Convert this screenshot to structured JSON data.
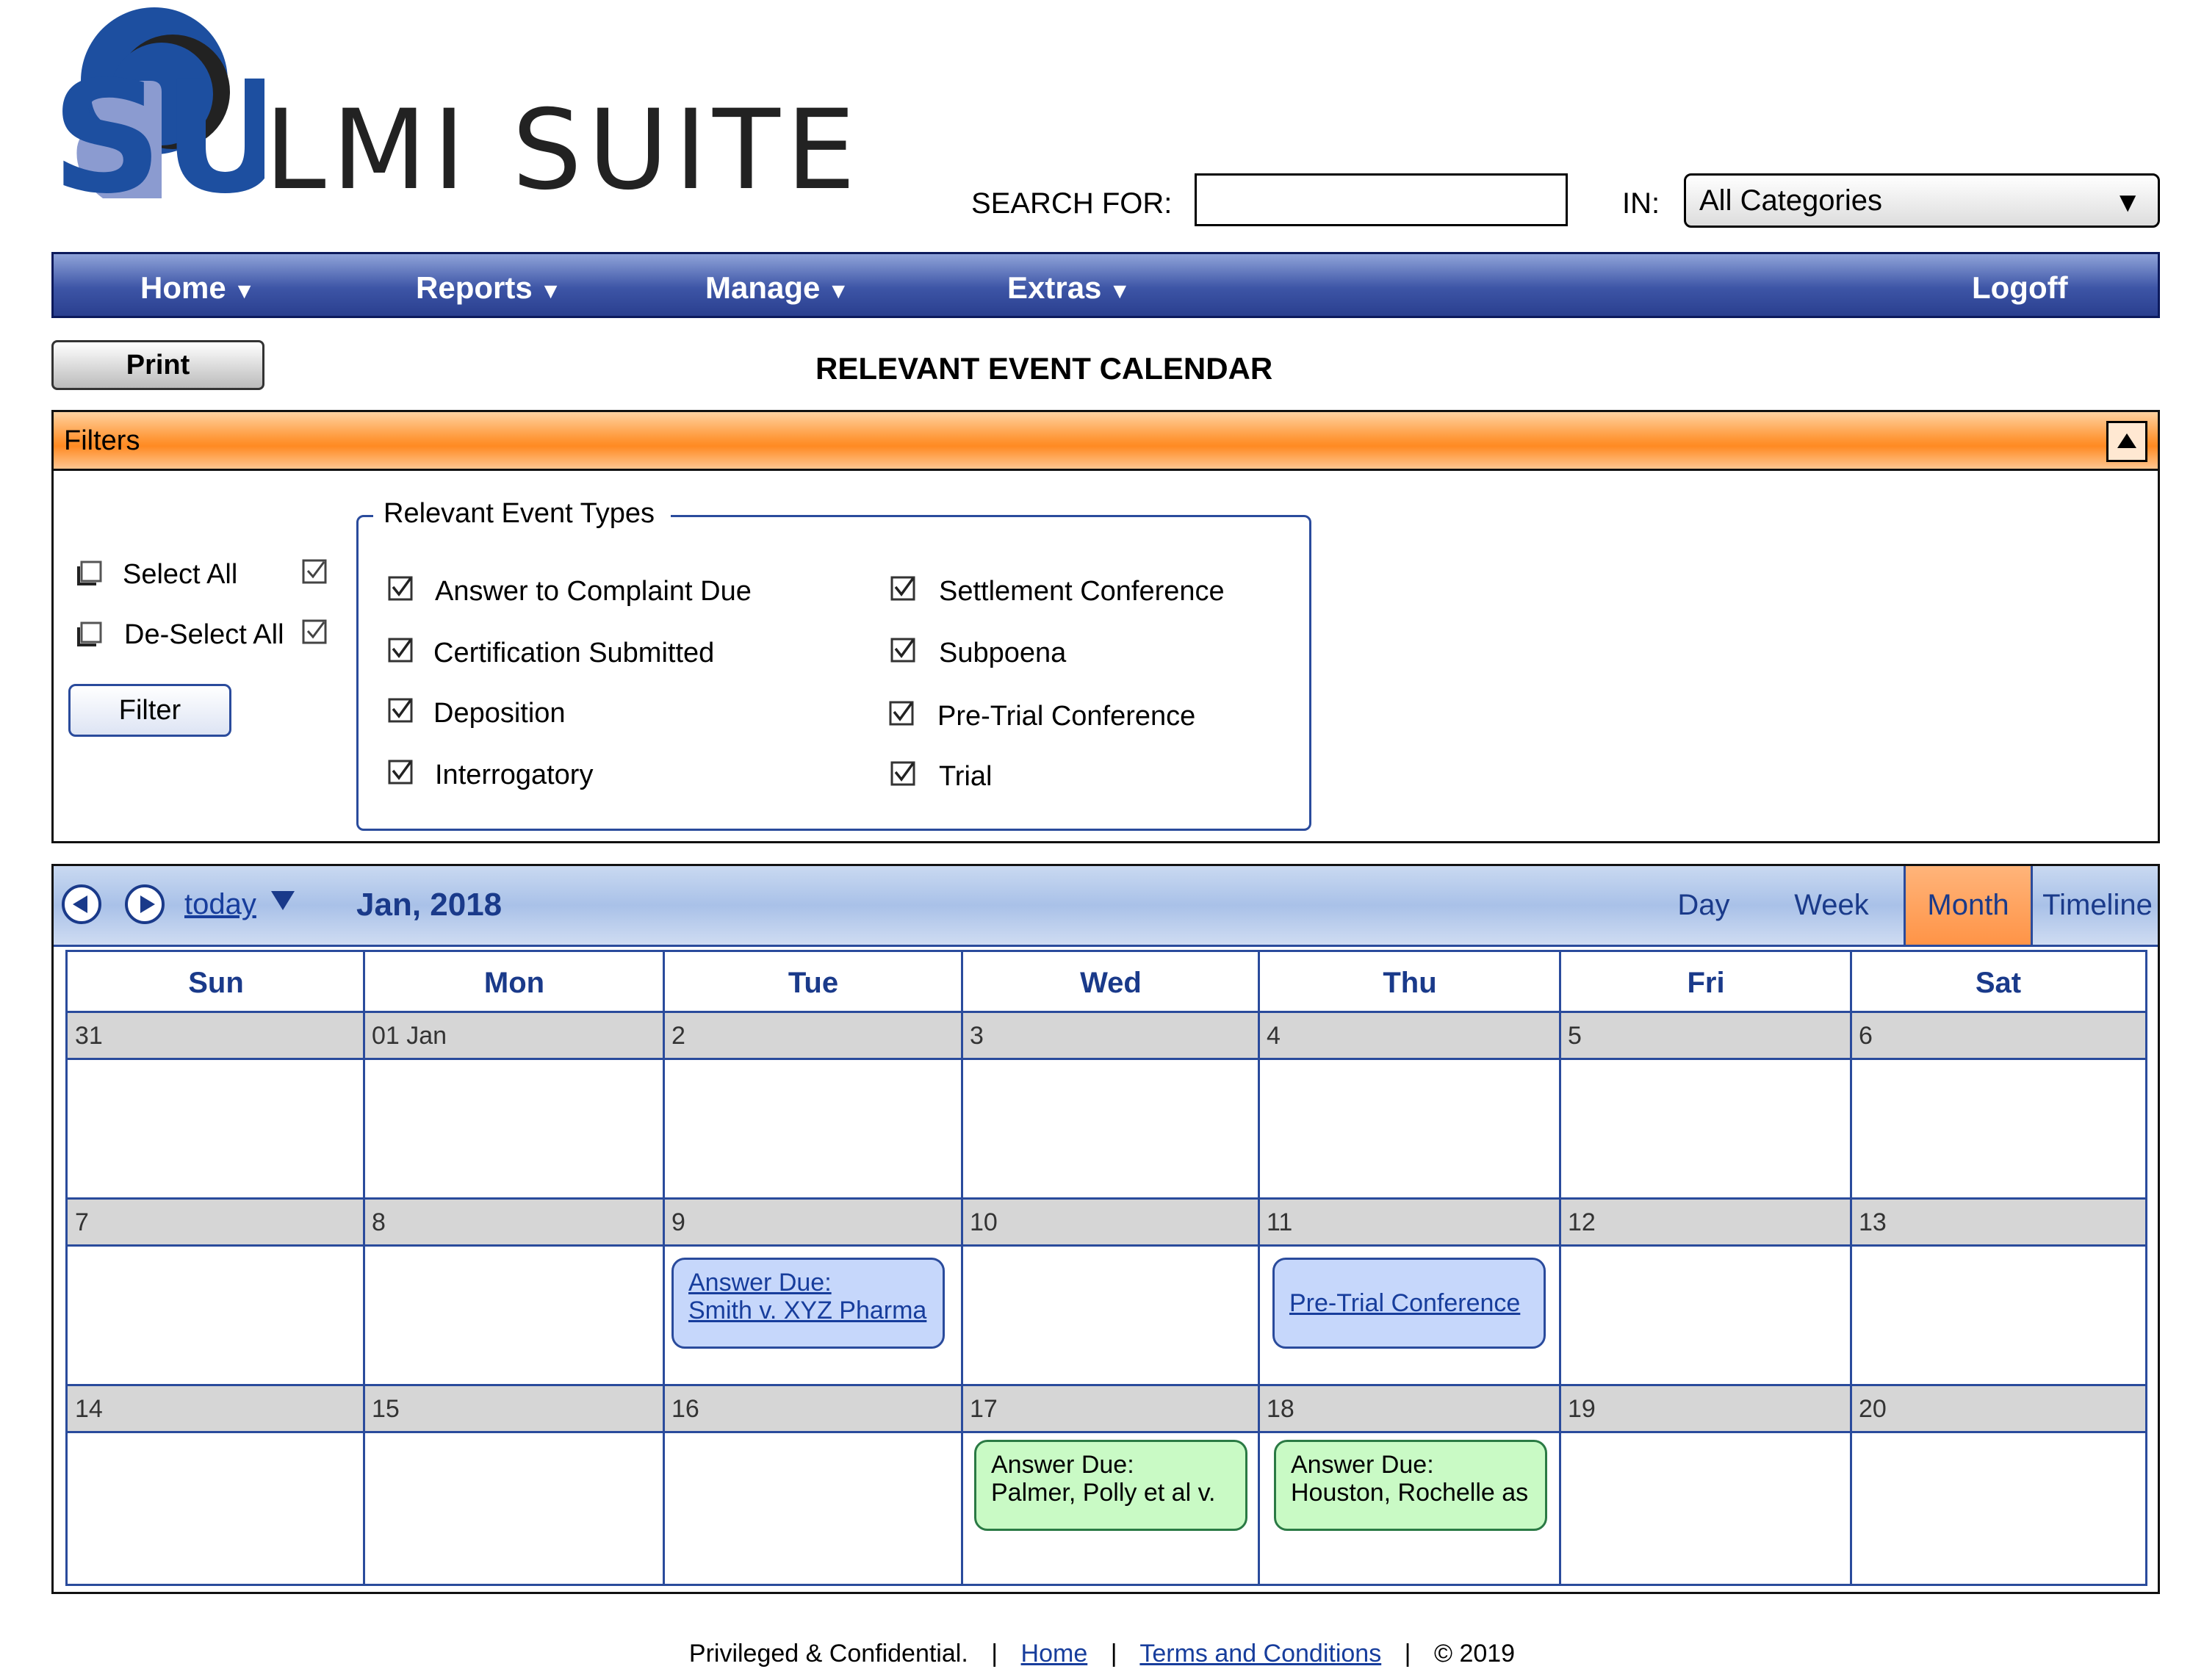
{
  "header": {
    "app_title": "LMI SUITE",
    "logo_letters": "SU",
    "search_label": "SEARCH FOR:",
    "search_value": "",
    "in_label": "IN:",
    "category_value": "All Categories"
  },
  "nav": {
    "items": [
      {
        "label": "Home",
        "has_dropdown": true
      },
      {
        "label": "Reports",
        "has_dropdown": true
      },
      {
        "label": "Manage",
        "has_dropdown": true
      },
      {
        "label": "Extras",
        "has_dropdown": true
      }
    ],
    "logoff_label": "Logoff"
  },
  "page": {
    "print_label": "Print",
    "title": "RELEVANT EVENT CALENDAR"
  },
  "filters": {
    "title": "Filters",
    "select_all_label": "Select All",
    "deselect_all_label": "De-Select All",
    "filter_button_label": "Filter",
    "types_legend": "Relevant Event Types",
    "event_types": [
      {
        "label": "Answer to Complaint Due",
        "checked": true
      },
      {
        "label": "Certification Submitted",
        "checked": true
      },
      {
        "label": "Deposition",
        "checked": true
      },
      {
        "label": "Interrogatory",
        "checked": true
      },
      {
        "label": "Settlement Conference",
        "checked": true
      },
      {
        "label": "Subpoena",
        "checked": true
      },
      {
        "label": "Pre-Trial Conference",
        "checked": true
      },
      {
        "label": "Trial",
        "checked": true
      }
    ]
  },
  "calendar": {
    "today_label": "today",
    "month_label": "Jan, 2018",
    "views": [
      "Day",
      "Week",
      "Month",
      "Timeline"
    ],
    "active_view": "Month",
    "weekdays": [
      "Sun",
      "Mon",
      "Tue",
      "Wed",
      "Thu",
      "Fri",
      "Sat"
    ],
    "weeks": [
      [
        "31",
        "01 Jan",
        "2",
        "3",
        "4",
        "5",
        "6"
      ],
      [
        "7",
        "8",
        "9",
        "10",
        "11",
        "12",
        "13"
      ],
      [
        "14",
        "15",
        "16",
        "17",
        "18",
        "19",
        "20"
      ]
    ],
    "events": [
      {
        "line1": "Answer Due:",
        "line2": "Smith v. XYZ Pharma"
      },
      {
        "line1": "Pre-Trial Conference",
        "line2": ""
      },
      {
        "line1": "Answer Due:",
        "line2": "Palmer, Polly et al v."
      },
      {
        "line1": "Answer Due:",
        "line2": "Houston, Rochelle as"
      }
    ]
  },
  "footer": {
    "confidential": "Privileged & Confidential.",
    "home_link": "Home",
    "terms_link": "Terms and Conditions",
    "copyright": "© 2019"
  },
  "colors": {
    "nav_blue": "#3d55a6",
    "accent_orange": "#ff8a22",
    "link_blue": "#173d9c",
    "event_blue": "#c6d7fb",
    "event_green": "#c9fac5"
  }
}
